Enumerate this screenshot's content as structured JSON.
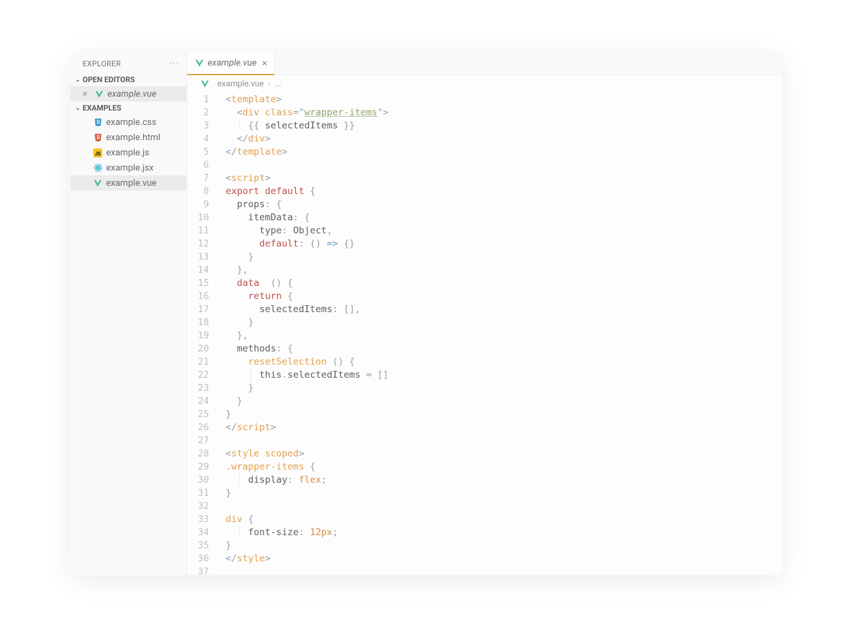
{
  "sidebar": {
    "title": "EXPLORER",
    "sections": {
      "openEditors": {
        "label": "OPEN EDITORS",
        "items": [
          {
            "name": "example.vue",
            "iconType": "vue",
            "active": true
          }
        ]
      },
      "project": {
        "label": "EXAMPLES",
        "items": [
          {
            "name": "example.css",
            "iconType": "css",
            "active": false
          },
          {
            "name": "example.html",
            "iconType": "html",
            "active": false
          },
          {
            "name": "example.js",
            "iconType": "js",
            "active": false
          },
          {
            "name": "example.jsx",
            "iconType": "jsx",
            "active": false
          },
          {
            "name": "example.vue",
            "iconType": "vue",
            "active": true
          }
        ]
      }
    }
  },
  "tabs": [
    {
      "name": "example.vue",
      "iconType": "vue",
      "active": true
    }
  ],
  "breadcrumb": {
    "file": "example.vue",
    "rest": "..."
  },
  "code": {
    "lineCount": 37,
    "lines": [
      [
        {
          "t": "<",
          "c": "pun"
        },
        {
          "t": "template",
          "c": "tag"
        },
        {
          "t": ">",
          "c": "pun"
        }
      ],
      [
        {
          "t": "  ",
          "c": ""
        },
        {
          "t": "<",
          "c": "pun"
        },
        {
          "t": "div ",
          "c": "tag"
        },
        {
          "t": "class",
          "c": "att"
        },
        {
          "t": "=",
          "c": "pun"
        },
        {
          "t": "\"",
          "c": "pun"
        },
        {
          "t": "wrapper-items",
          "c": "und"
        },
        {
          "t": "\"",
          "c": "pun"
        },
        {
          "t": ">",
          "c": "pun"
        }
      ],
      [
        {
          "t": "  ",
          "c": ""
        },
        {
          "t": "│ ",
          "c": "guide"
        },
        {
          "t": "{{ ",
          "c": "pun"
        },
        {
          "t": "selectedItems",
          "c": "var"
        },
        {
          "t": " }}",
          "c": "pun"
        }
      ],
      [
        {
          "t": "  ",
          "c": ""
        },
        {
          "t": "</",
          "c": "pun"
        },
        {
          "t": "div",
          "c": "tag"
        },
        {
          "t": ">",
          "c": "pun"
        }
      ],
      [
        {
          "t": "</",
          "c": "pun"
        },
        {
          "t": "template",
          "c": "tag"
        },
        {
          "t": ">",
          "c": "pun"
        }
      ],
      [
        {
          "t": "",
          "c": ""
        }
      ],
      [
        {
          "t": "<",
          "c": "pun"
        },
        {
          "t": "script",
          "c": "tag"
        },
        {
          "t": ">",
          "c": "pun"
        }
      ],
      [
        {
          "t": "export default",
          "c": "kw"
        },
        {
          "t": " {",
          "c": "pun"
        }
      ],
      [
        {
          "t": "  ",
          "c": ""
        },
        {
          "t": "props",
          "c": "prop"
        },
        {
          "t": ": {",
          "c": "pun"
        }
      ],
      [
        {
          "t": "    ",
          "c": ""
        },
        {
          "t": "itemData",
          "c": "prop"
        },
        {
          "t": ": {",
          "c": "pun"
        }
      ],
      [
        {
          "t": "      ",
          "c": ""
        },
        {
          "t": "type",
          "c": "prop"
        },
        {
          "t": ": ",
          "c": "pun"
        },
        {
          "t": "Object",
          "c": "var"
        },
        {
          "t": ",",
          "c": "pun"
        }
      ],
      [
        {
          "t": "      ",
          "c": ""
        },
        {
          "t": "default",
          "c": "kw"
        },
        {
          "t": ": ",
          "c": "pun"
        },
        {
          "t": "() ",
          "c": "pun"
        },
        {
          "t": "=>",
          "c": "op"
        },
        {
          "t": " {}",
          "c": "pun"
        }
      ],
      [
        {
          "t": "    }",
          "c": "pun"
        }
      ],
      [
        {
          "t": "  },",
          "c": "pun"
        }
      ],
      [
        {
          "t": "  ",
          "c": ""
        },
        {
          "t": "data",
          "c": "kw"
        },
        {
          "t": "  () {",
          "c": "pun"
        }
      ],
      [
        {
          "t": "    ",
          "c": ""
        },
        {
          "t": "return",
          "c": "kw"
        },
        {
          "t": " {",
          "c": "pun"
        }
      ],
      [
        {
          "t": "      ",
          "c": ""
        },
        {
          "t": "selectedItems",
          "c": "prop"
        },
        {
          "t": ": [],",
          "c": "pun"
        }
      ],
      [
        {
          "t": "    }",
          "c": "pun"
        }
      ],
      [
        {
          "t": "  },",
          "c": "pun"
        }
      ],
      [
        {
          "t": "  ",
          "c": ""
        },
        {
          "t": "methods",
          "c": "prop"
        },
        {
          "t": ": {",
          "c": "pun"
        }
      ],
      [
        {
          "t": "    ",
          "c": ""
        },
        {
          "t": "resetSelection",
          "c": "fn"
        },
        {
          "t": " () {",
          "c": "pun"
        }
      ],
      [
        {
          "t": "    ",
          "c": ""
        },
        {
          "t": "│ ",
          "c": "guide"
        },
        {
          "t": "this",
          "c": "var"
        },
        {
          "t": ".",
          "c": "pun"
        },
        {
          "t": "selectedItems",
          "c": "prop"
        },
        {
          "t": " = []",
          "c": "pun"
        }
      ],
      [
        {
          "t": "    }",
          "c": "pun"
        }
      ],
      [
        {
          "t": "  }",
          "c": "pun"
        }
      ],
      [
        {
          "t": "}",
          "c": "pun"
        }
      ],
      [
        {
          "t": "</",
          "c": "pun"
        },
        {
          "t": "script",
          "c": "tag"
        },
        {
          "t": ">",
          "c": "pun"
        }
      ],
      [
        {
          "t": "",
          "c": ""
        }
      ],
      [
        {
          "t": "<",
          "c": "pun"
        },
        {
          "t": "style ",
          "c": "tag"
        },
        {
          "t": "scoped",
          "c": "att"
        },
        {
          "t": ">",
          "c": "pun"
        }
      ],
      [
        {
          "t": ".wrapper-items",
          "c": "css-sel"
        },
        {
          "t": " {",
          "c": "pun"
        }
      ],
      [
        {
          "t": "  ",
          "c": ""
        },
        {
          "t": "│ ",
          "c": "guide"
        },
        {
          "t": "display",
          "c": "css-prop"
        },
        {
          "t": ": ",
          "c": "pun"
        },
        {
          "t": "flex",
          "c": "css-val"
        },
        {
          "t": ";",
          "c": "pun"
        }
      ],
      [
        {
          "t": "}",
          "c": "pun"
        }
      ],
      [
        {
          "t": "",
          "c": ""
        }
      ],
      [
        {
          "t": "div",
          "c": "css-sel"
        },
        {
          "t": " {",
          "c": "pun"
        }
      ],
      [
        {
          "t": "  ",
          "c": ""
        },
        {
          "t": "│ ",
          "c": "guide"
        },
        {
          "t": "font-size",
          "c": "css-prop"
        },
        {
          "t": ": ",
          "c": "pun"
        },
        {
          "t": "12",
          "c": "num"
        },
        {
          "t": "px",
          "c": "css-val"
        },
        {
          "t": ";",
          "c": "pun"
        }
      ],
      [
        {
          "t": "}",
          "c": "pun"
        }
      ],
      [
        {
          "t": "</",
          "c": "pun"
        },
        {
          "t": "style",
          "c": "tag"
        },
        {
          "t": ">",
          "c": "pun"
        }
      ],
      [
        {
          "t": "",
          "c": ""
        }
      ]
    ]
  }
}
